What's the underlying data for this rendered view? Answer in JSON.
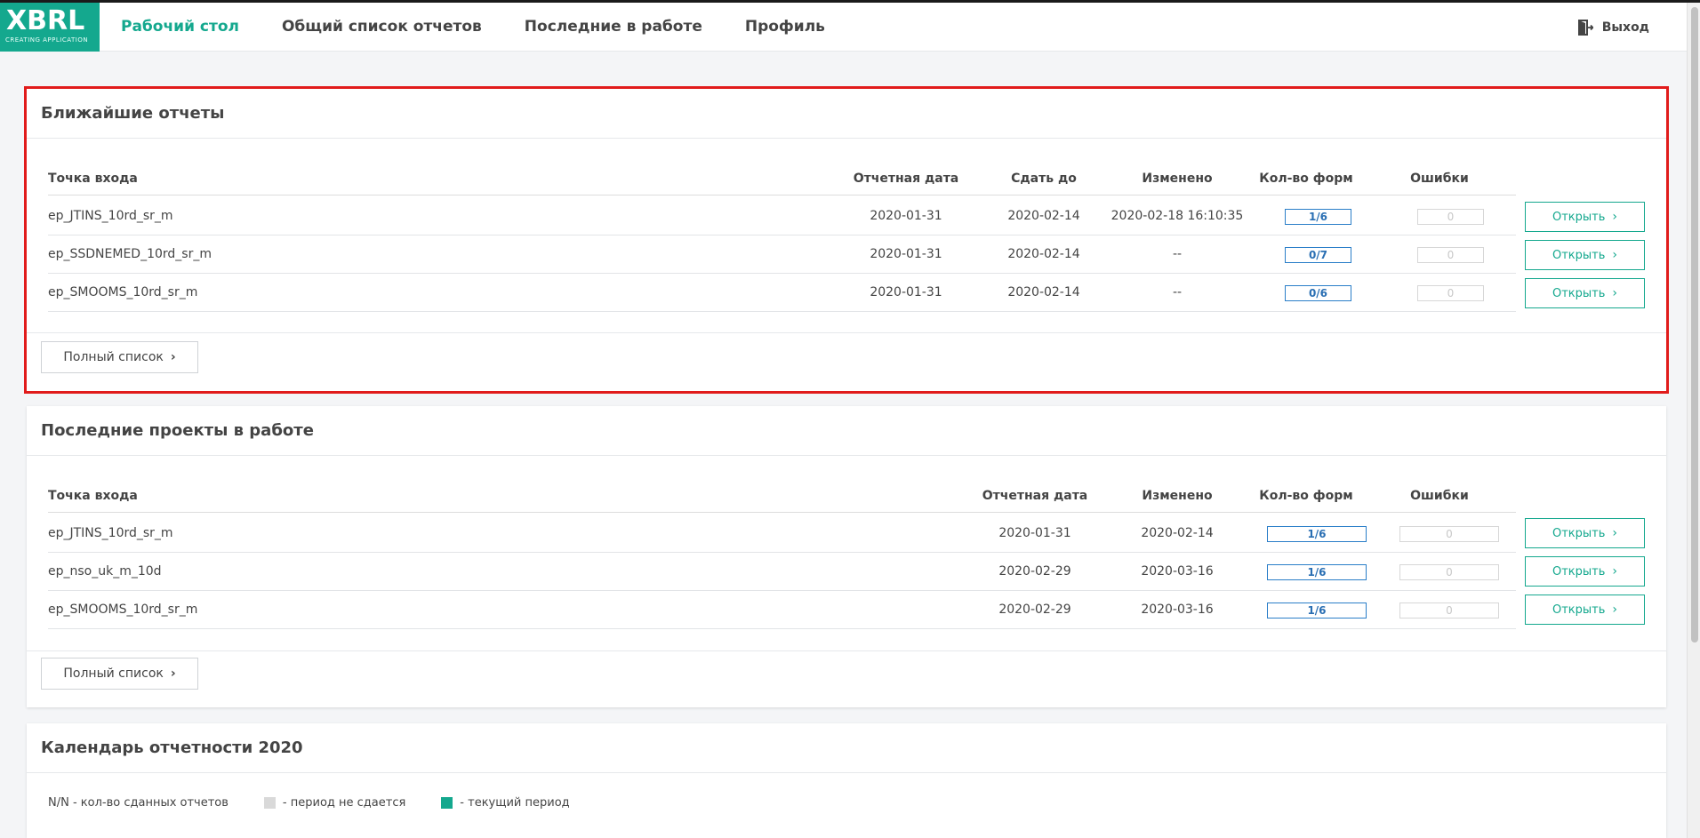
{
  "header": {
    "logo_text": "XBRL",
    "logo_sub": "CREATING APPLICATION",
    "nav": [
      {
        "label": "Рабочий стол"
      },
      {
        "label": "Общий список отчетов"
      },
      {
        "label": "Последние в работе"
      },
      {
        "label": "Профиль"
      }
    ],
    "logout_label": "Выход",
    "colors": {
      "accent": "#14a88e",
      "highlight": "#e11b1b"
    }
  },
  "upcoming": {
    "title": "Ближайшие отчеты",
    "columns": {
      "entry": "Точка входа",
      "report_date": "Отчетная дата",
      "due": "Сдать до",
      "changed": "Изменено",
      "forms": "Кол-во форм",
      "errors": "Ошибки"
    },
    "rows": [
      {
        "entry": "ep_JTINS_10rd_sr_m",
        "report_date": "2020-01-31",
        "due": "2020-02-14",
        "changed": "2020-02-18 16:10:35",
        "forms": "1/6",
        "errors": "0",
        "open": "Открыть"
      },
      {
        "entry": "ep_SSDNEMED_10rd_sr_m",
        "report_date": "2020-01-31",
        "due": "2020-02-14",
        "changed": "--",
        "forms": "0/7",
        "errors": "0",
        "open": "Открыть"
      },
      {
        "entry": "ep_SMOOMS_10rd_sr_m",
        "report_date": "2020-01-31",
        "due": "2020-02-14",
        "changed": "--",
        "forms": "0/6",
        "errors": "0",
        "open": "Открыть"
      }
    ],
    "full_list_label": "Полный список"
  },
  "recent": {
    "title": "Последние проекты в работе",
    "columns": {
      "entry": "Точка входа",
      "report_date": "Отчетная дата",
      "changed": "Изменено",
      "forms": "Кол-во форм",
      "errors": "Ошибки"
    },
    "rows": [
      {
        "entry": "ep_JTINS_10rd_sr_m",
        "report_date": "2020-01-31",
        "changed": "2020-02-14",
        "forms": "1/6",
        "errors": "0",
        "open": "Открыть"
      },
      {
        "entry": "ep_nso_uk_m_10d",
        "report_date": "2020-02-29",
        "changed": "2020-03-16",
        "forms": "1/6",
        "errors": "0",
        "open": "Открыть"
      },
      {
        "entry": "ep_SMOOMS_10rd_sr_m",
        "report_date": "2020-02-29",
        "changed": "2020-03-16",
        "forms": "1/6",
        "errors": "0",
        "open": "Открыть"
      }
    ],
    "full_list_label": "Полный список"
  },
  "calendar": {
    "title": "Календарь отчетности 2020",
    "legend": {
      "count": "N/N - кол-во сданных отчетов",
      "not_due": "- период не сдается",
      "current": "- текущий период"
    },
    "colors": {
      "not_due": "#d9d9d9",
      "current": "#14a88e"
    }
  }
}
